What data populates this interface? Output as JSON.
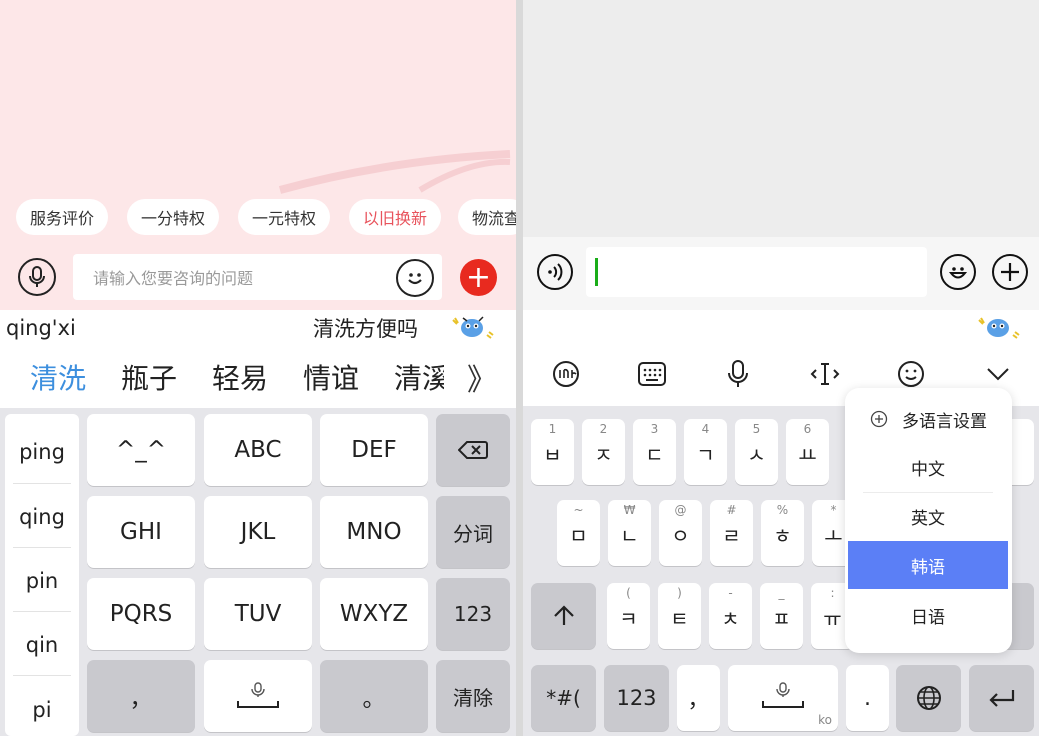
{
  "left": {
    "chips": [
      {
        "label": "服务评价",
        "highlight": false
      },
      {
        "label": "一分特权",
        "highlight": false
      },
      {
        "label": "一元特权",
        "highlight": false
      },
      {
        "label": "以旧换新",
        "highlight": true
      },
      {
        "label": "物流查",
        "highlight": false
      }
    ],
    "input_placeholder": "请输入您要咨询的问题",
    "plus_symbol": "+",
    "composition": "qing'xi",
    "prediction": "清洗方便吗",
    "candidates": [
      "清洗",
      "瓶子",
      "轻易",
      "情谊",
      "清溪"
    ],
    "expand_symbol": "》",
    "pinyin_options": [
      "ping",
      "qing",
      "pin",
      "qin",
      "pi"
    ],
    "keys": {
      "row1": [
        "^_^",
        "ABC",
        "DEF"
      ],
      "row2": [
        "GHI",
        "JKL",
        "MNO"
      ],
      "row3": [
        "PQRS",
        "TUV",
        "WXYZ"
      ],
      "comma": "，",
      "period": "。",
      "segment": "分词",
      "numbers": "123",
      "clear": "清除"
    }
  },
  "right": {
    "korean_row1": [
      {
        "hint": "1",
        "char": "ㅂ"
      },
      {
        "hint": "2",
        "char": "ㅈ"
      },
      {
        "hint": "3",
        "char": "ㄷ"
      },
      {
        "hint": "4",
        "char": "ㄱ"
      },
      {
        "hint": "5",
        "char": "ㅅ"
      },
      {
        "hint": "6",
        "char": "ㅛ"
      }
    ],
    "korean_row2": [
      {
        "hint": "~",
        "char": "ㅁ"
      },
      {
        "hint": "₩",
        "char": "ㄴ"
      },
      {
        "hint": "@",
        "char": "ㅇ"
      },
      {
        "hint": "#",
        "char": "ㄹ"
      },
      {
        "hint": "%",
        "char": "ㅎ"
      },
      {
        "hint": "*",
        "char": "ㅗ"
      }
    ],
    "korean_row3": [
      {
        "hint": "(",
        "char": "ㅋ"
      },
      {
        "hint": ")",
        "char": "ㅌ"
      },
      {
        "hint": "-",
        "char": "ㅊ"
      },
      {
        "hint": "_",
        "char": "ㅍ"
      },
      {
        "hint": ":",
        "char": "ㅠ"
      }
    ],
    "bottom_keys": {
      "symbols": "*#(",
      "numbers": "123",
      "comma": "，",
      "space_lang": "ko",
      "period": "."
    },
    "language_popup": {
      "title": "多语言设置",
      "items": [
        {
          "label": "中文",
          "active": false
        },
        {
          "label": "英文",
          "active": false
        },
        {
          "label": "韩语",
          "active": true
        },
        {
          "label": "日语",
          "active": false
        }
      ]
    }
  },
  "colors": {
    "accent_blue": "#3d8fde",
    "popup_active": "#5b7ff6",
    "plus_red": "#e82a1f",
    "chip_highlight": "#e8535c",
    "caret_green": "#1aad19"
  }
}
